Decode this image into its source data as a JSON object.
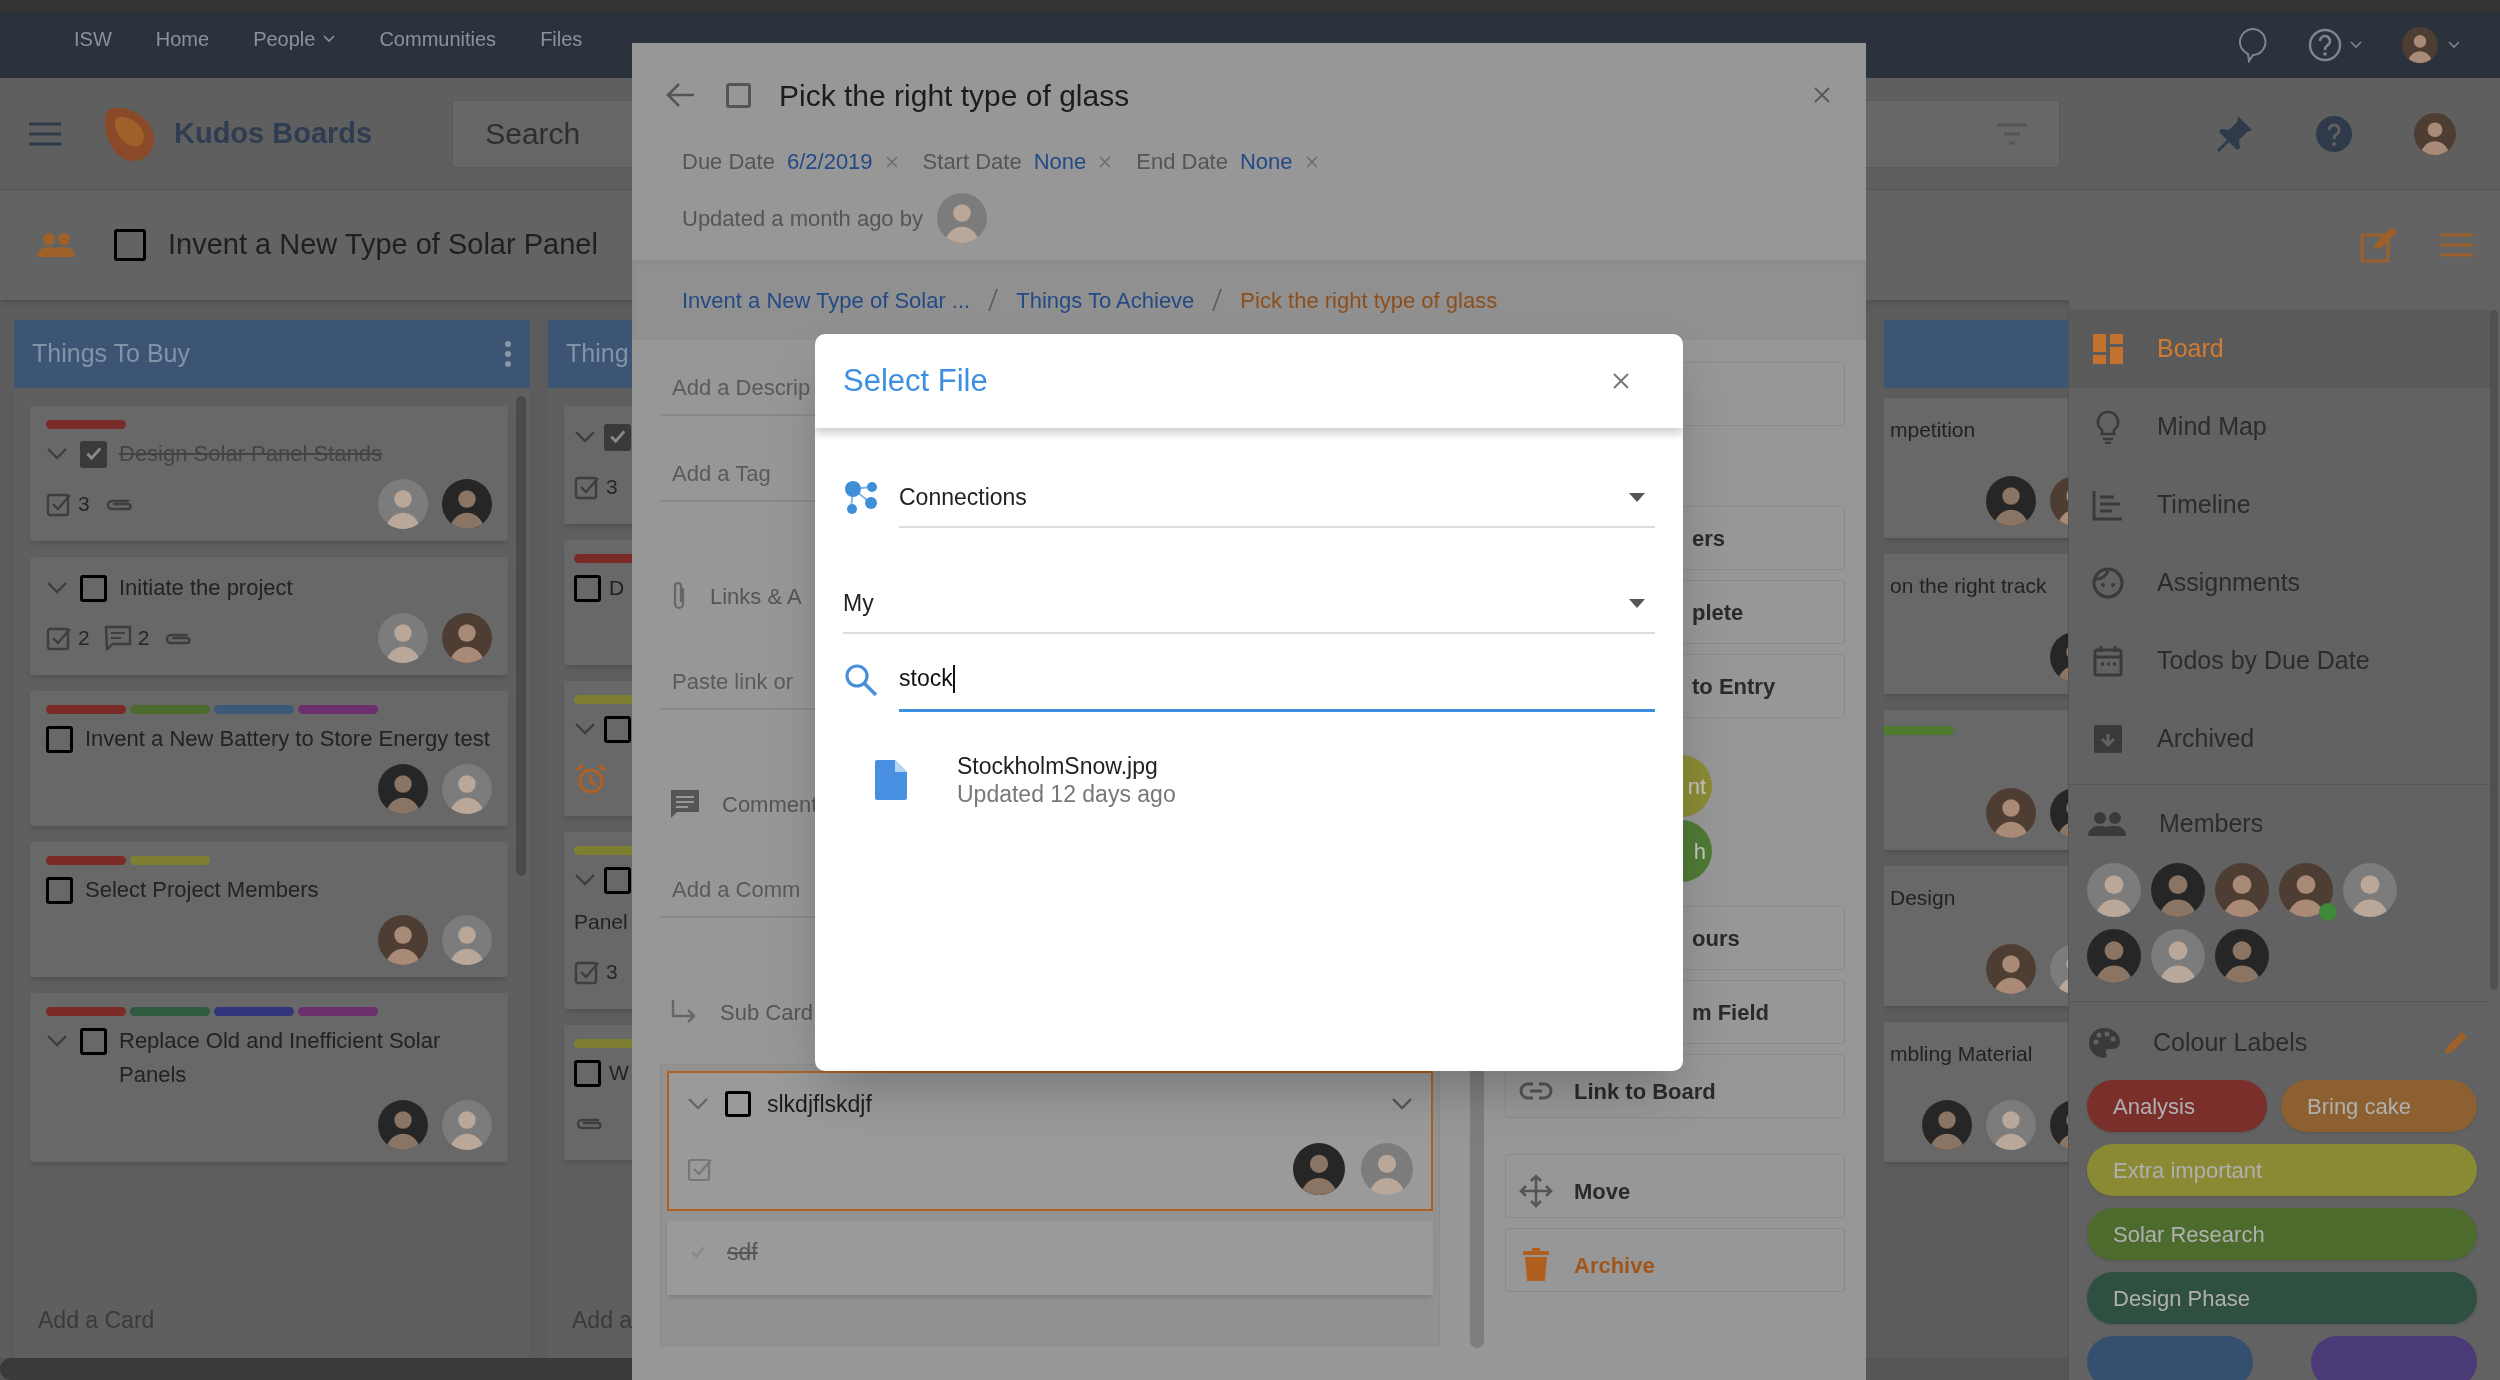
{
  "top_nav": {
    "items": [
      {
        "label": "ISW",
        "dropdown": false
      },
      {
        "label": "Home",
        "dropdown": false
      },
      {
        "label": "People",
        "dropdown": true
      },
      {
        "label": "Communities",
        "dropdown": false
      },
      {
        "label": "Files",
        "dropdown": false
      }
    ],
    "user_avatar": {
      "kind": "warm"
    }
  },
  "header": {
    "app_name": "Kudos Boards",
    "search_placeholder": "Search",
    "user_avatar": {
      "kind": "warm"
    }
  },
  "board_bar": {
    "title": "Invent a New Type of Solar Panel",
    "checked": false
  },
  "columns": [
    {
      "kind": "full",
      "title": "Things To Buy",
      "menu": true,
      "footer": "Add a Card",
      "cards": [
        {
          "labels": [
            {
              "color": "#7a2a27"
            }
          ],
          "expandable": true,
          "checked": true,
          "done": true,
          "title": "Design Solar Panel Stands",
          "badges": [
            {
              "kind": "checklist",
              "count": "3"
            },
            {
              "kind": "attachment"
            }
          ],
          "avatars": [
            {
              "kind": "light"
            },
            {
              "kind": "dark"
            }
          ]
        },
        {
          "expandable": true,
          "checked": false,
          "done": false,
          "title": "Initiate the project",
          "badges": [
            {
              "kind": "checklist",
              "count": "2"
            },
            {
              "kind": "comments",
              "count": "2"
            },
            {
              "kind": "attachment"
            }
          ],
          "avatars": [
            {
              "kind": "light"
            },
            {
              "kind": "warm"
            }
          ]
        },
        {
          "labels": [
            {
              "color": "#7a2a27"
            },
            {
              "color": "#4d6b2c"
            },
            {
              "color": "#3a5a78"
            },
            {
              "color": "#6b2f6e"
            }
          ],
          "expandable": false,
          "checked": false,
          "done": false,
          "title": "Invent a New Battery to Store Energy test",
          "avatars": [
            {
              "kind": "dark"
            },
            {
              "kind": "light"
            }
          ]
        },
        {
          "labels": [
            {
              "color": "#7a2a27"
            },
            {
              "color": "#7f7f32"
            }
          ],
          "expandable": false,
          "checked": false,
          "done": false,
          "title": "Select Project Members",
          "avatars": [
            {
              "kind": "warm"
            },
            {
              "kind": "light"
            }
          ]
        },
        {
          "labels": [
            {
              "color": "#7a2a27"
            },
            {
              "color": "#2e5a40"
            },
            {
              "color": "#33357a"
            },
            {
              "color": "#6b2f6e"
            }
          ],
          "expandable": true,
          "checked": false,
          "done": false,
          "title": "Replace Old and Inefficient Solar Panels",
          "avatars": [
            {
              "kind": "dark"
            },
            {
              "kind": "light"
            }
          ]
        }
      ]
    },
    {
      "kind": "clip",
      "title": "Thing",
      "menu": false,
      "footer": "Add a",
      "cards": [
        {
          "expandable": true,
          "checked": true,
          "badges": [
            {
              "kind": "checklist",
              "count": "3"
            }
          ]
        },
        {
          "labels": [
            {
              "color": "#7a2a27"
            }
          ],
          "expandable": false,
          "checked": false,
          "done": false,
          "title": "D"
        },
        {
          "labels": [
            {
              "color": "#7f7f32"
            }
          ],
          "expandable": true,
          "checked": false,
          "badges": [
            {
              "kind": "alarm"
            }
          ]
        },
        {
          "labels": [
            {
              "color": "#7f7f32"
            }
          ],
          "expandable": true,
          "checked": false,
          "done": false,
          "title": "Panel",
          "badges": [
            {
              "kind": "checklist",
              "count": "3"
            }
          ]
        },
        {
          "labels": [
            {
              "color": "#7f7f32"
            }
          ],
          "expandable": false,
          "checked": false,
          "done": false,
          "title": "W",
          "badges": [
            {
              "kind": "attachment"
            }
          ]
        }
      ]
    }
  ],
  "right_column": {
    "cards": [
      {
        "title": "mpetition",
        "avatars": [
          {
            "kind": "dark"
          },
          {
            "kind": "warm"
          }
        ]
      },
      {
        "title": "on the right track",
        "avatars": [
          {
            "kind": "dark"
          }
        ]
      },
      {
        "labels": [
          {
            "color": "#4d7a2c"
          }
        ],
        "avatars": [
          {
            "kind": "warm"
          },
          {
            "kind": "dark"
          }
        ]
      },
      {
        "title": "Design",
        "avatars": [
          {
            "kind": "warm"
          },
          {
            "kind": "light"
          }
        ]
      },
      {
        "title": "mbling Material",
        "avatars": [
          {
            "kind": "dark"
          },
          {
            "kind": "light"
          },
          {
            "kind": "dark"
          }
        ]
      }
    ]
  },
  "sidebar": {
    "views": [
      {
        "label": "Board",
        "kind": "board",
        "selected": true
      },
      {
        "label": "Mind Map",
        "kind": "mindmap",
        "selected": false
      },
      {
        "label": "Timeline",
        "kind": "timeline",
        "selected": false
      },
      {
        "label": "Assignments",
        "kind": "assignments",
        "selected": false
      },
      {
        "label": "Todos by Due Date",
        "kind": "calendar",
        "selected": false
      },
      {
        "label": "Archived",
        "kind": "archive",
        "selected": false
      }
    ],
    "members_title": "Members",
    "members": [
      {
        "kind": "light",
        "online": false
      },
      {
        "kind": "dark",
        "online": false
      },
      {
        "kind": "warm",
        "online": false
      },
      {
        "kind": "warm",
        "online": true
      },
      {
        "kind": "light",
        "online": false
      },
      {
        "kind": "dark",
        "online": false
      },
      {
        "kind": "light",
        "online": false
      },
      {
        "kind": "dark",
        "online": false
      }
    ],
    "labels_title": "Colour Labels",
    "labels": [
      {
        "name": "Analysis",
        "color": "#7b2f2b"
      },
      {
        "name": "Bring cake",
        "color": "#8c6030"
      },
      {
        "name": "Extra important",
        "color": "#8a8a35"
      },
      {
        "name": "Solar Research",
        "color": "#4d6b2c"
      },
      {
        "name": "Design Phase",
        "color": "#2f5040"
      },
      {
        "color": "#34506e"
      },
      {
        "color": "#4a3a78"
      }
    ]
  },
  "card_detail": {
    "title": "Pick the right type of glass",
    "checked": false,
    "dates": [
      {
        "label": "Due Date",
        "value": "6/2/2019"
      },
      {
        "label": "Start Date",
        "value": "None"
      },
      {
        "label": "End Date",
        "value": "None"
      }
    ],
    "updated": "Updated a month ago by",
    "updated_avatar": {
      "kind": "light"
    },
    "breadcrumbs": [
      {
        "label": "Invent a New Type of Solar ...",
        "current": false
      },
      {
        "label": "Things To Achieve",
        "current": false
      },
      {
        "label": "Pick the right type of glass",
        "current": true
      }
    ],
    "fields": [
      {
        "kind": "input",
        "placeholder": "Add a Descrip"
      },
      {
        "kind": "input",
        "placeholder": "Add a Tag"
      },
      {
        "kind": "attachments",
        "label": "Links & A"
      },
      {
        "kind": "input",
        "placeholder": "Paste link or"
      },
      {
        "kind": "comments",
        "label": "Comment"
      },
      {
        "kind": "input",
        "placeholder": "Add a Comm"
      },
      {
        "kind": "subcards",
        "label": "Sub Card"
      }
    ],
    "subcards": [
      {
        "title": "slkdjflskdjf",
        "checked": false,
        "focused": true,
        "avatars": [
          {
            "kind": "dark"
          },
          {
            "kind": "light"
          }
        ]
      },
      {
        "title": "sdf",
        "checked": true,
        "focused": false
      }
    ],
    "actions": [
      {
        "kind": "blank"
      },
      {
        "kind": "partial",
        "label": "ers"
      },
      {
        "kind": "partial",
        "label": "plete"
      },
      {
        "kind": "partial",
        "label": "to Entry"
      },
      {
        "kind": "chip",
        "label": "nt",
        "color": "#8a8a35"
      },
      {
        "kind": "chip",
        "label": "h",
        "color": "#4f7a35"
      },
      {
        "kind": "partial",
        "label": "ours"
      },
      {
        "kind": "partial",
        "label": "m Field"
      },
      {
        "kind": "link",
        "label": "Link to Board",
        "accent": false
      },
      {
        "kind": "move",
        "label": "Move",
        "accent": false
      },
      {
        "kind": "archive",
        "label": "Archive",
        "accent": true
      }
    ]
  },
  "file_dialog": {
    "title": "Select File",
    "source": {
      "label": "Connections"
    },
    "scope": {
      "label": "My"
    },
    "search": {
      "value": "stock"
    },
    "results": [
      {
        "name": "StockholmSnow.jpg",
        "meta": "Updated 12 days ago"
      }
    ]
  }
}
